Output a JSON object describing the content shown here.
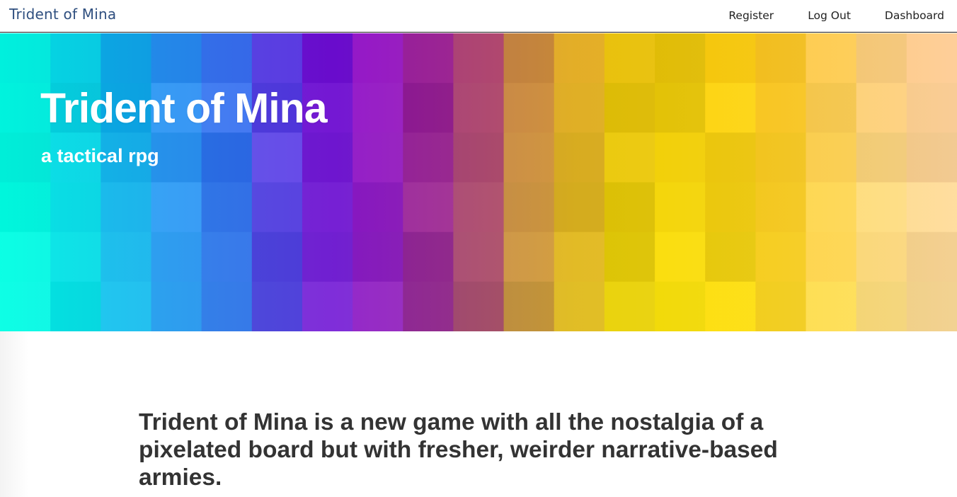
{
  "navbar": {
    "brand": "Trident of Mina",
    "links": [
      {
        "label": "Register"
      },
      {
        "label": "Log Out"
      },
      {
        "label": "Dashboard"
      }
    ]
  },
  "hero": {
    "title": "Trident of Mina",
    "subtitle": "a tactical rpg"
  },
  "main": {
    "intro": "Trident of Mina is a new game with all the nostalgia of a pixelated board but with fresher, weirder narrative-based armies."
  },
  "colors": {
    "brand": "#2f4f7f",
    "text_dark": "#333333",
    "hero_text": "#ffffff",
    "palette": [
      "#00ffd8",
      "#1ea0ff",
      "#5a3dff",
      "#8b00d8",
      "#b03080",
      "#d4a000",
      "#f0d000",
      "#ffc800",
      "#ffd890"
    ]
  }
}
